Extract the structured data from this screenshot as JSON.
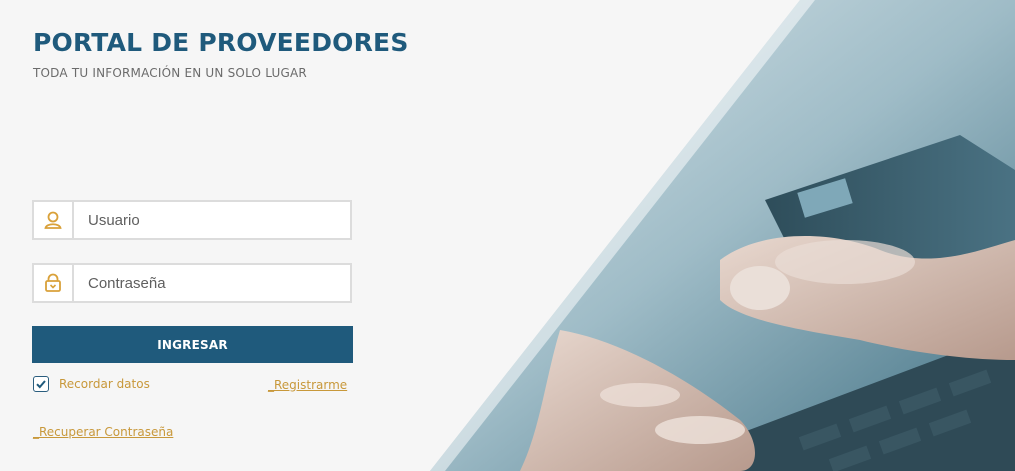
{
  "header": {
    "title": "PORTAL DE PROVEEDORES",
    "subtitle": "TODA TU INFORMACIÓN EN UN SOLO LUGAR"
  },
  "form": {
    "user": {
      "placeholder": "Usuario",
      "value": "",
      "icon": "user-icon"
    },
    "password": {
      "placeholder": "Contraseña",
      "value": "",
      "icon": "lock-icon"
    },
    "submit_label": "INGRESAR",
    "remember_label": "Recordar datos",
    "remember_checked": true,
    "register_link": "_Registrarme",
    "recover_link": "_Recuperar Contraseña"
  },
  "colors": {
    "brand": "#1f5a7c",
    "link": "#c8983a",
    "icon": "#d9a13a",
    "background": "#f6f6f6"
  }
}
